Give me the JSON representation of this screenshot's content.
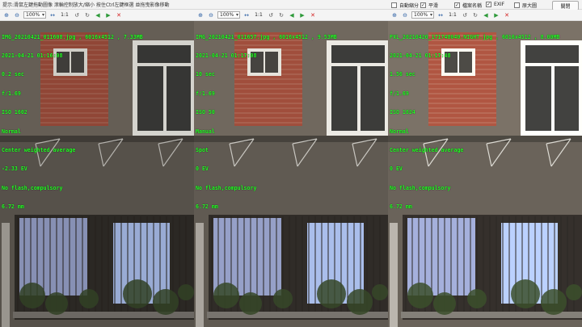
{
  "hint_text": "提示:滑鼠左鍵拖動圖像 滾輪控制放大/縮小 按住Ctrl左鍵框選 並拖曳影像移動",
  "options": [
    {
      "label": "自動縮分",
      "checked": false
    },
    {
      "label": "平滑",
      "checked": true
    },
    {
      "label": "檔案名稱",
      "checked": true
    },
    {
      "label": "EXIF",
      "checked": true
    },
    {
      "label": "原大圖",
      "checked": false
    }
  ],
  "close_label": "關閉",
  "toolbar": {
    "zoom_value": "100%",
    "one_to_one": "1:1"
  },
  "panels": [
    {
      "exif_lines": [
        "IMG_20210421_011608.jpg , 6016x4512 , 7.33MB",
        "2021-04-21 01:16:08",
        "0.2 sec",
        "f/1.69",
        "ISO 1602",
        "Normal",
        "Center weighted average",
        "-2.33 EV",
        "No flash,compulsory",
        "6.72 mm"
      ],
      "light": 0.9
    },
    {
      "exif_lines": [
        "IMG_20210421_011657.jpg , 6016x4512 , 9.53MB",
        "2021-04-21 01:17:08",
        "10 sec",
        "f/1.69",
        "ISO 50",
        "Manual",
        "Spot",
        "0 EV",
        "No flash,compulsory",
        "6.72 mm"
      ],
      "light": 1.0
    },
    {
      "exif_lines": [
        "PXL_20210420_171748040.NIGHT.jpg , 6016x4512 , 8.00MB",
        "2021-04-21 01:17:48",
        "1.56 sec",
        "f/1.69",
        "ISO 1024",
        "Normal",
        "Center weighted average",
        "0 EV",
        "No flash,compulsory",
        "6.72 mm"
      ],
      "light": 1.1
    }
  ]
}
